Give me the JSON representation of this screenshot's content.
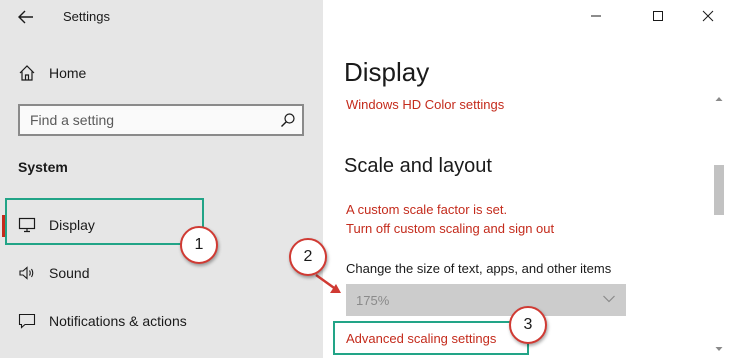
{
  "window": {
    "app_title": "Settings"
  },
  "sidebar": {
    "home_label": "Home",
    "search_placeholder": "Find a setting",
    "section_title": "System",
    "items": [
      {
        "label": "Display",
        "icon": "monitor-icon",
        "active": true
      },
      {
        "label": "Sound",
        "icon": "speaker-icon",
        "active": false
      },
      {
        "label": "Notifications & actions",
        "icon": "message-icon",
        "active": false
      }
    ]
  },
  "main": {
    "page_title": "Display",
    "hd_color_link": "Windows HD Color settings",
    "scale_section_title": "Scale and layout",
    "warning_line1": "A custom scale factor is set.",
    "warning_line2": "Turn off custom scaling and sign out",
    "scale_label": "Change the size of text, apps, and other items",
    "scale_value": "175%",
    "advanced_scaling_link": "Advanced scaling settings"
  },
  "annotations": {
    "step1": "1",
    "step2": "2",
    "step3": "3"
  },
  "colors": {
    "accent_red": "#c42b1c",
    "annotation_green": "#22a487",
    "badge_border": "#d03a33",
    "sidebar_bg": "#e6e6e6"
  }
}
